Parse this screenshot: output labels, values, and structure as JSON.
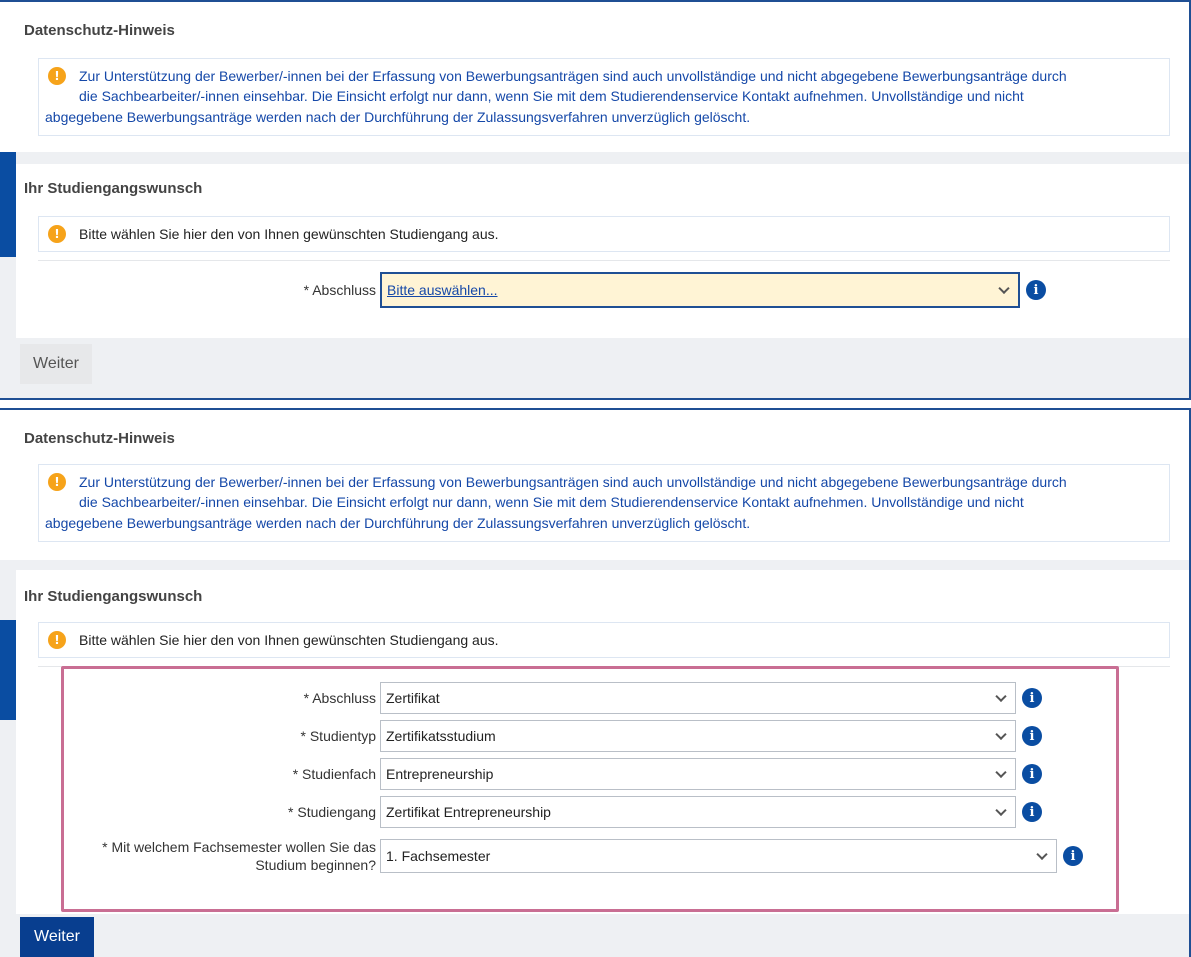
{
  "panel_before": {
    "privacy": {
      "title": "Datenschutz-Hinweis",
      "notice_line1": "Zur Unterstützung der Bewerber/-innen bei der Erfassung von Bewerbungsanträgen sind auch unvollständige und nicht abgegebene Bewerbungsanträge durch",
      "notice_line2": "die Sachbearbeiter/-innen einsehbar. Die Einsicht erfolgt nur dann, wenn Sie mit dem Studierendenservice Kontakt aufnehmen. Unvollständige und nicht",
      "notice_line3": "abgegebene Bewerbungsanträge werden nach der Durchführung der Zulassungsverfahren unverzüglich gelöscht."
    },
    "study": {
      "title": "Ihr Studiengangswunsch",
      "hint": "Bitte wählen Sie hier den von Ihnen gewünschten Studiengang aus.",
      "abschluss_label": "* Abschluss",
      "abschluss_value": "Bitte auswählen..."
    },
    "next_label": "Weiter"
  },
  "panel_after": {
    "privacy": {
      "title": "Datenschutz-Hinweis",
      "notice_line1": "Zur Unterstützung der Bewerber/-innen bei der Erfassung von Bewerbungsanträgen sind auch unvollständige und nicht abgegebene Bewerbungsanträge durch",
      "notice_line2": "die Sachbearbeiter/-innen einsehbar. Die Einsicht erfolgt nur dann, wenn Sie mit dem Studierendenservice Kontakt aufnehmen. Unvollständige und nicht",
      "notice_line3": "abgegebene Bewerbungsanträge werden nach der Durchführung der Zulassungsverfahren unverzüglich gelöscht."
    },
    "study": {
      "title": "Ihr Studiengangswunsch",
      "hint": "Bitte wählen Sie hier den von Ihnen gewünschten Studiengang aus.",
      "fields": [
        {
          "label": "* Abschluss",
          "value": "Zertifikat"
        },
        {
          "label": "* Studientyp",
          "value": "Zertifikatsstudium"
        },
        {
          "label": "* Studienfach",
          "value": "Entrepreneurship"
        },
        {
          "label": "* Studiengang",
          "value": "Zertifikat Entrepreneurship"
        }
      ],
      "semester_label_line1": "* Mit welchem Fachsemester wollen Sie das",
      "semester_label_line2": "Studium beginnen?",
      "semester_value": "1. Fachsemester"
    },
    "next_label": "Weiter"
  },
  "icons": {
    "warning": "!",
    "info": "i"
  },
  "colors": {
    "primary": "#083e8f",
    "link": "#1548a8",
    "warning": "#f6a31a",
    "highlight": "#c96e93",
    "focus_bg": "#fff4d5"
  }
}
